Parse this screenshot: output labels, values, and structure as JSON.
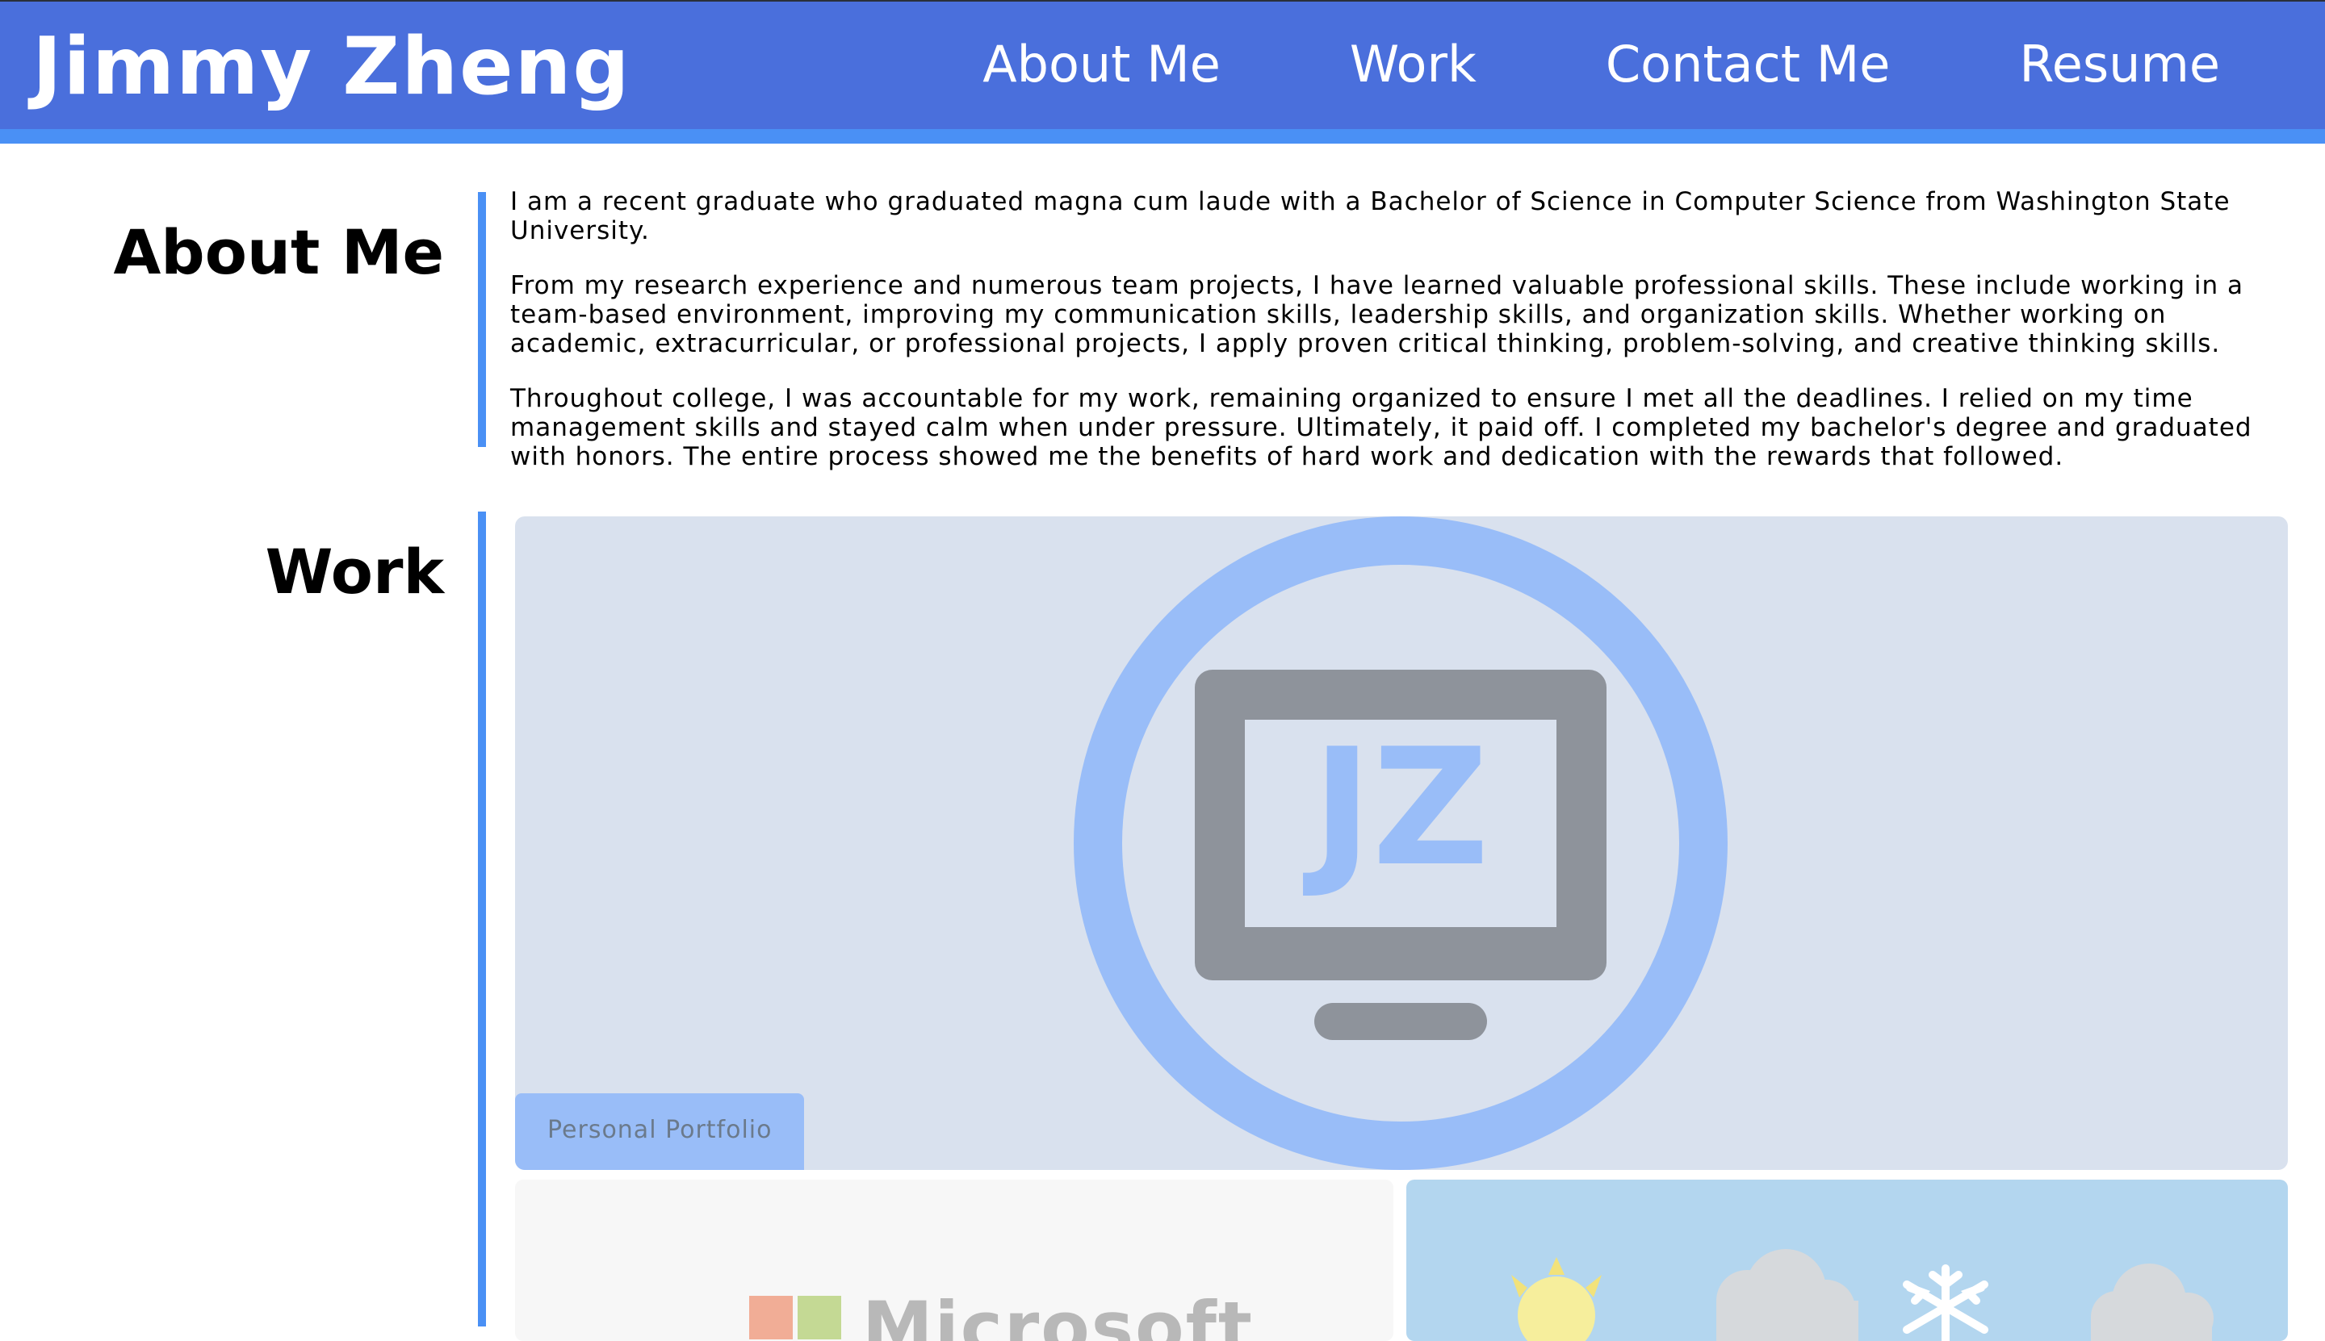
{
  "header": {
    "brand": "Jimmy Zheng",
    "nav": [
      {
        "label": "About Me"
      },
      {
        "label": "Work"
      },
      {
        "label": "Contact Me"
      },
      {
        "label": "Resume"
      }
    ]
  },
  "about": {
    "title": "About Me",
    "paragraphs": [
      "I am a recent graduate who graduated magna cum laude with a Bachelor of Science in Computer Science from Washington State University.",
      "From my research experience and numerous team projects, I have learned valuable professional skills. These include working in a team-based environment, improving my communication skills, leadership skills, and organization skills. Whether working on academic, extracurricular, or professional projects, I apply proven critical thinking, problem-solving, and creative thinking skills.",
      "Throughout college, I was accountable for my work, remaining organized to ensure I met all the deadlines. I relied on my time management skills and stayed calm when under pressure. Ultimately, it paid off. I completed my bachelor's degree and graduated with honors. The entire process showed me the benefits of hard work and dedication with the rewards that followed."
    ]
  },
  "work": {
    "title": "Work",
    "projects": [
      {
        "label": "Personal Portfolio",
        "logo_text": "JZ",
        "icon": "monitor-logo-icon"
      },
      {
        "logo_text": "Microsoft",
        "icon": "microsoft-logo-icon"
      },
      {
        "icon": "weather-app-icon"
      }
    ]
  },
  "colors": {
    "header_bg": "#4a6fdc",
    "accent": "#4a90f5",
    "card_bg": "#d9e1ee",
    "logo_blue": "#99bdf8",
    "logo_gray": "#8e939b"
  }
}
